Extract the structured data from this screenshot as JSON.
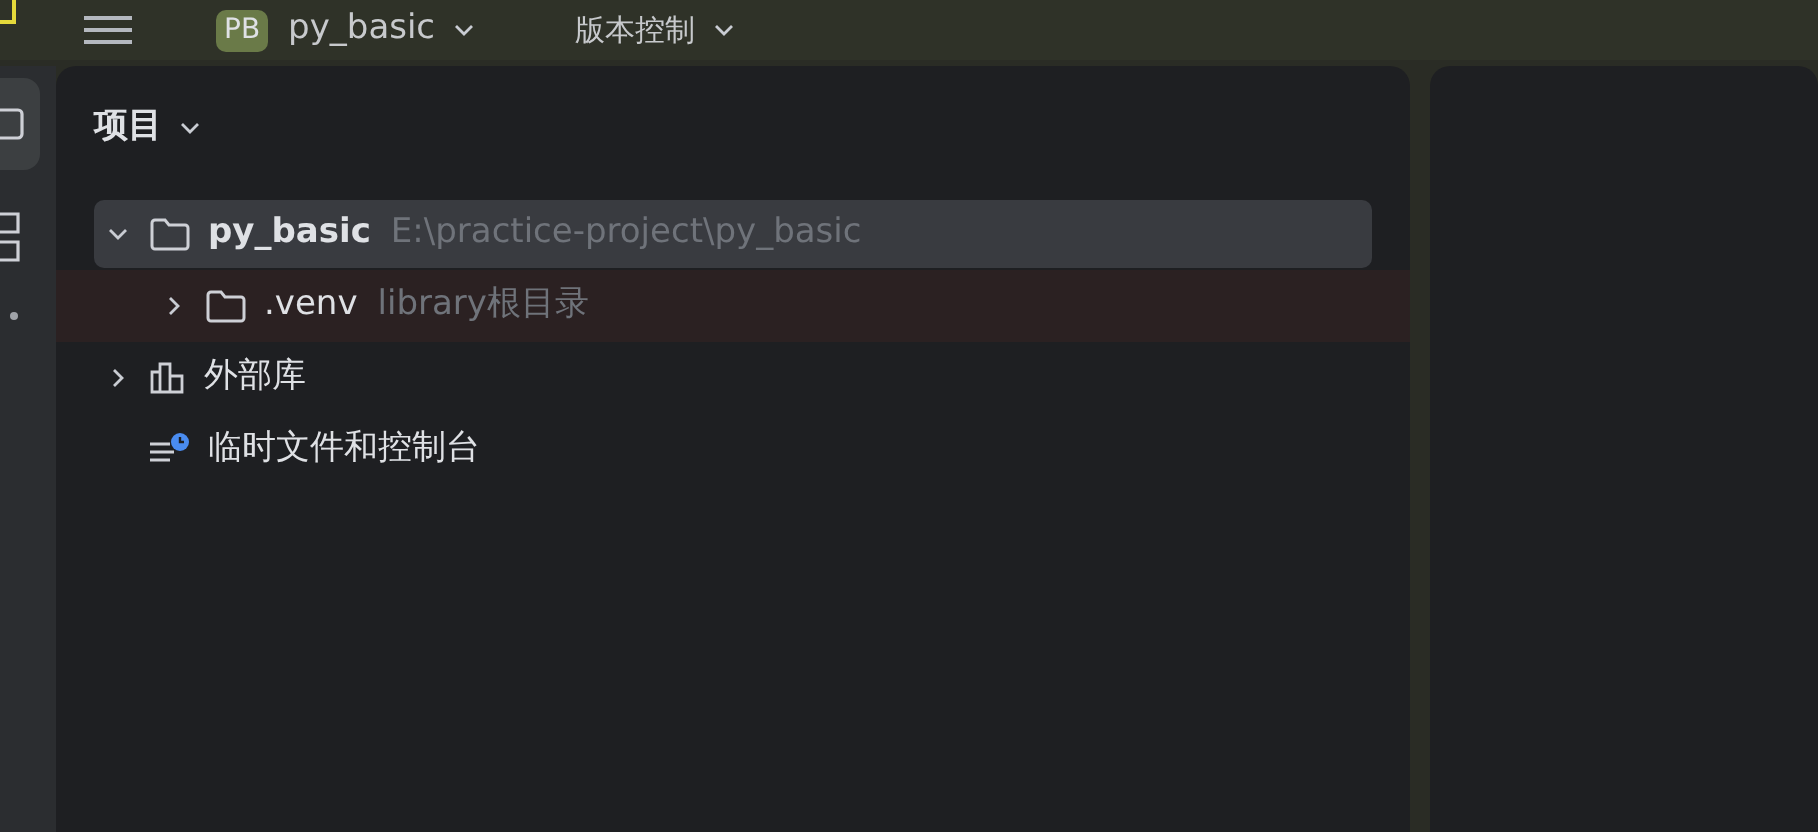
{
  "top_bar": {
    "project_badge": "PB",
    "project_name": "py_basic",
    "vcs_menu": "版本控制"
  },
  "project_panel": {
    "title": "项目"
  },
  "tree": [
    {
      "kind": "folder",
      "name": "py_basic",
      "detail": "E:\\practice-project\\py_basic",
      "expanded": true,
      "selected": true,
      "tinted": false,
      "children": [
        {
          "kind": "folder",
          "name": ".venv",
          "detail": "library根目录",
          "expanded": false,
          "selected": false,
          "tinted": true
        }
      ]
    },
    {
      "kind": "library",
      "name": "外部库",
      "expanded": false,
      "selected": false,
      "tinted": false
    },
    {
      "kind": "scratches",
      "name": "临时文件和控制台",
      "selected": false,
      "tinted": false
    }
  ]
}
